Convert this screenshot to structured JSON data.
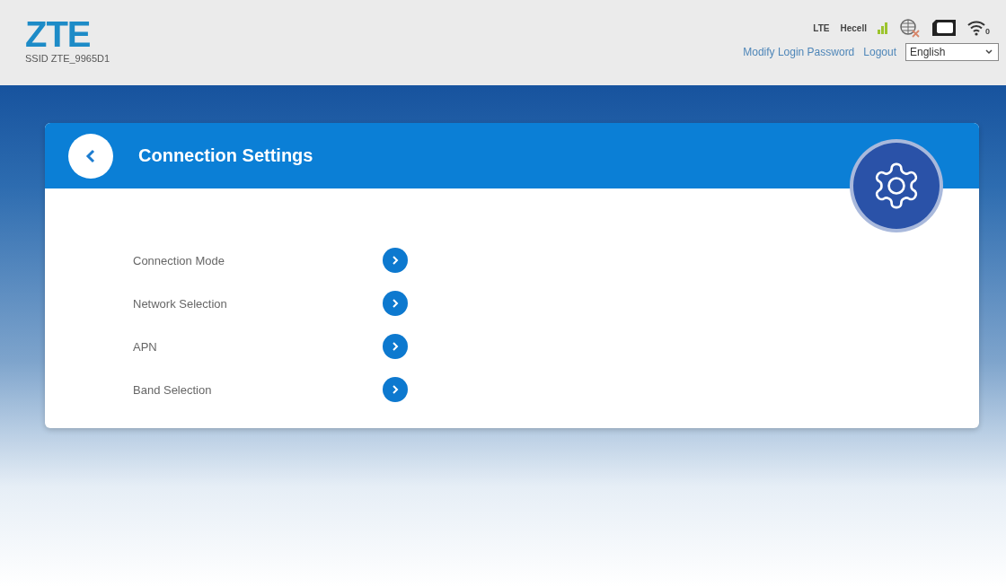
{
  "header": {
    "logo": "ZTE",
    "ssid": "SSID ZTE_9965D1",
    "network_type": "LTE",
    "operator": "Hecell",
    "wifi_clients": "0",
    "links": [
      "Modify Login Password",
      "Logout"
    ],
    "language": "English"
  },
  "card": {
    "title": "Connection Settings",
    "items": [
      {
        "label": "Connection Mode"
      },
      {
        "label": "Network Selection"
      },
      {
        "label": "APN"
      },
      {
        "label": "Band Selection"
      }
    ]
  }
}
